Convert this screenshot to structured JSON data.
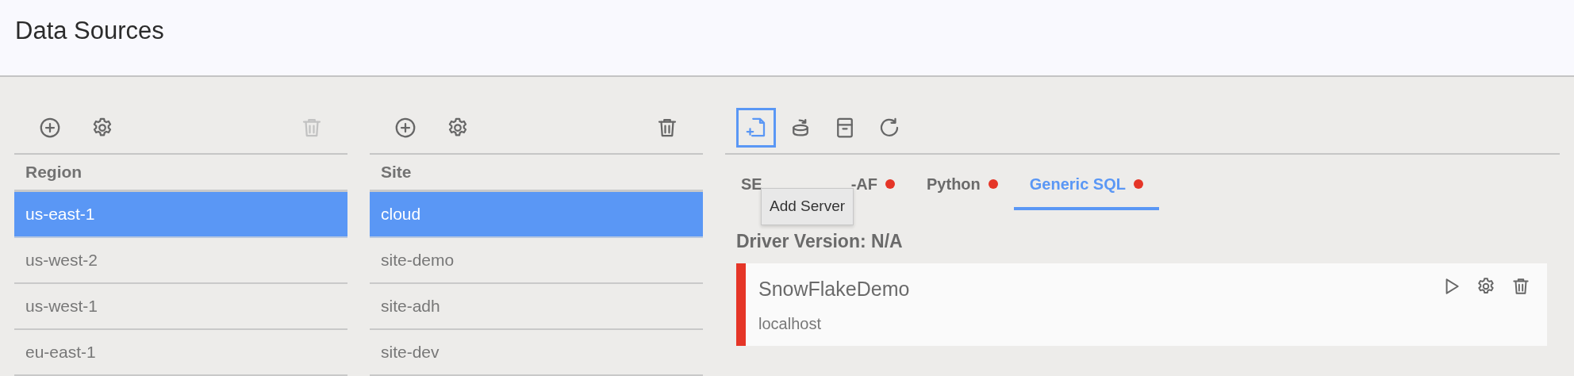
{
  "page": {
    "title": "Data Sources"
  },
  "regions": {
    "toolbar": [
      {
        "kind": "add",
        "disabled": false
      },
      {
        "kind": "settings",
        "disabled": false
      },
      {
        "kind": "delete",
        "disabled": true
      }
    ],
    "column": "Region",
    "rows": [
      {
        "label": "us-east-1",
        "selected": true
      },
      {
        "label": "us-west-2",
        "selected": false
      },
      {
        "label": "us-west-1",
        "selected": false
      },
      {
        "label": "eu-east-1",
        "selected": false
      }
    ]
  },
  "sites": {
    "toolbar": [
      {
        "kind": "add",
        "disabled": false
      },
      {
        "kind": "settings",
        "disabled": false
      },
      {
        "kind": "delete",
        "disabled": false
      }
    ],
    "column": "Site",
    "rows": [
      {
        "label": "cloud",
        "selected": true
      },
      {
        "label": "site-demo",
        "selected": false
      },
      {
        "label": "site-adh",
        "selected": false
      },
      {
        "label": "site-dev",
        "selected": false
      }
    ]
  },
  "servers": {
    "toolbar": [
      {
        "kind": "add-server",
        "focused": true
      },
      {
        "kind": "sync",
        "focused": false
      },
      {
        "kind": "archive",
        "focused": false
      },
      {
        "kind": "refresh",
        "focused": false
      }
    ],
    "tooltip": "Add Server",
    "tabs": [
      {
        "label_start": "SE",
        "label_end": "-AF",
        "color": "#e53527",
        "selected": false
      },
      {
        "label": "Python",
        "color": "#e53527",
        "selected": false
      },
      {
        "label": "Generic SQL",
        "color": "#e53527",
        "selected": true
      }
    ],
    "driver_version": "Driver Version: N/A",
    "items": [
      {
        "name": "SnowFlakeDemo",
        "host": "localhost",
        "color": "#e53527"
      }
    ]
  }
}
